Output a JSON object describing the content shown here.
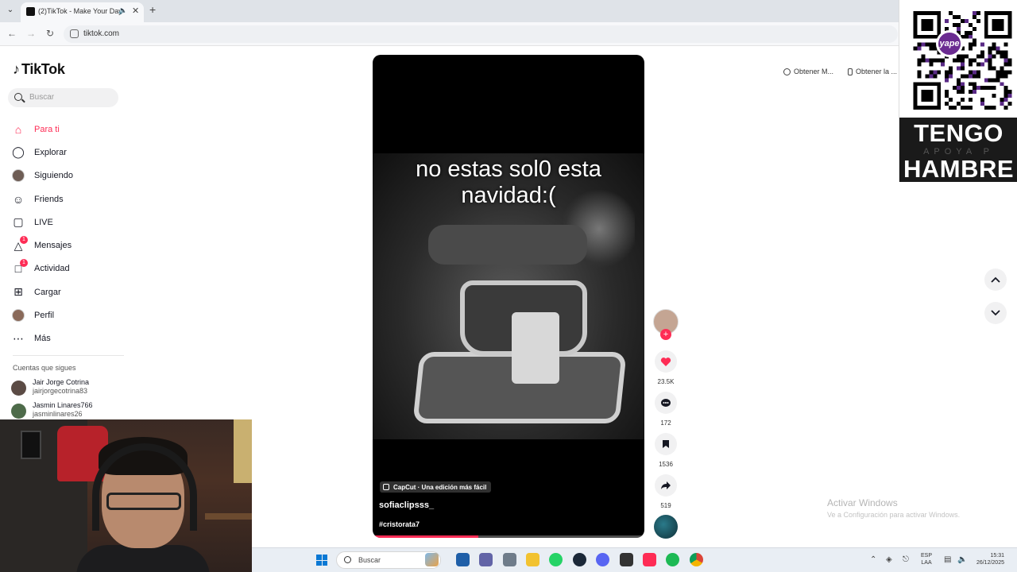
{
  "browser": {
    "tab_title": "(2)TikTok - Make Your Day",
    "url": "tiktok.com"
  },
  "sidebar": {
    "logo_text": "TikTok",
    "search_placeholder": "Buscar",
    "nav": [
      {
        "label": "Para ti",
        "icon": "home-icon",
        "active": true
      },
      {
        "label": "Explorar",
        "icon": "compass-icon"
      },
      {
        "label": "Siguiendo",
        "icon": "following-avatar"
      },
      {
        "label": "Friends",
        "icon": "friends-icon"
      },
      {
        "label": "LIVE",
        "icon": "live-icon"
      },
      {
        "label": "Mensajes",
        "icon": "messages-icon",
        "badge": "1"
      },
      {
        "label": "Actividad",
        "icon": "activity-icon",
        "badge": "1"
      },
      {
        "label": "Cargar",
        "icon": "upload-icon"
      },
      {
        "label": "Perfil",
        "icon": "profile-avatar"
      },
      {
        "label": "Más",
        "icon": "more-icon"
      }
    ],
    "following_title": "Cuentas que sigues",
    "following": [
      {
        "name": "Jair Jorge Cotrina",
        "handle": "jairjorgecotrina83"
      },
      {
        "name": "Jasmin Linares766",
        "handle": "jasminlinares26"
      }
    ]
  },
  "video": {
    "caption": "no estas sol0 esta navidad:(",
    "capcut_label": "CapCut · Una edición más fácil",
    "author": "sofiaclipsss_",
    "hashtag": "#cristorata7",
    "progress": 0.39
  },
  "actions": {
    "likes": "23.5K",
    "comments": "172",
    "saves": "1536",
    "shares": "519"
  },
  "promos": {
    "get_app": "Obtener M...",
    "get_desktop": "Obtener la ..."
  },
  "overlay": {
    "qr_brand": "yape",
    "line1": "TENGO",
    "line2": "APOYA P",
    "line3": "HAMBRE"
  },
  "windows_activation": {
    "title": "Activar Windows",
    "subtitle": "Ve a Configuración para activar Windows."
  },
  "taskbar": {
    "search_placeholder": "Buscar",
    "lang_1": "ESP",
    "lang_2": "LAA",
    "time": "15:31",
    "date": "26/12/2025"
  },
  "colors": {
    "brand": "#fe2c55",
    "yape_purple": "#6b2c91"
  }
}
